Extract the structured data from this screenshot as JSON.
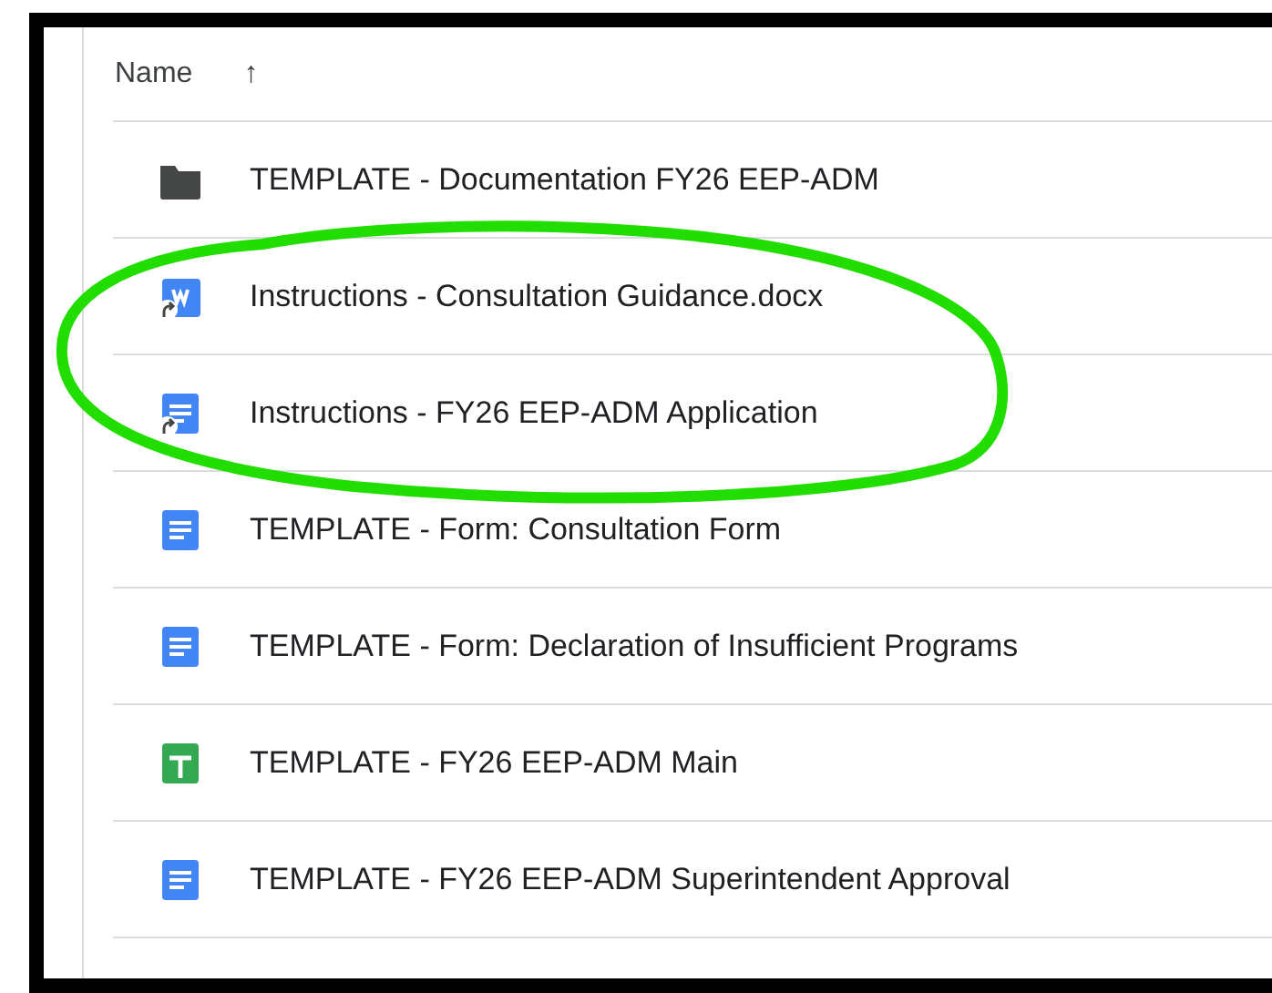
{
  "header": {
    "label": "Name",
    "sort_arrow": "↑"
  },
  "files": [
    {
      "name": "TEMPLATE - Documentation FY26 EEP-ADM",
      "kind": "folder",
      "shortcut": false
    },
    {
      "name": "Instructions - Consultation Guidance.docx",
      "kind": "word",
      "shortcut": true
    },
    {
      "name": "Instructions - FY26 EEP-ADM Application",
      "kind": "docs",
      "shortcut": true
    },
    {
      "name": "TEMPLATE - Form: Consultation Form",
      "kind": "docs",
      "shortcut": false
    },
    {
      "name": "TEMPLATE - Form: Declaration of Insufficient Programs",
      "kind": "docs",
      "shortcut": false
    },
    {
      "name": "TEMPLATE - FY26 EEP-ADM Main",
      "kind": "sheets",
      "shortcut": false
    },
    {
      "name": "TEMPLATE - FY26 EEP-ADM Superintendent Approval",
      "kind": "docs",
      "shortcut": false
    }
  ]
}
